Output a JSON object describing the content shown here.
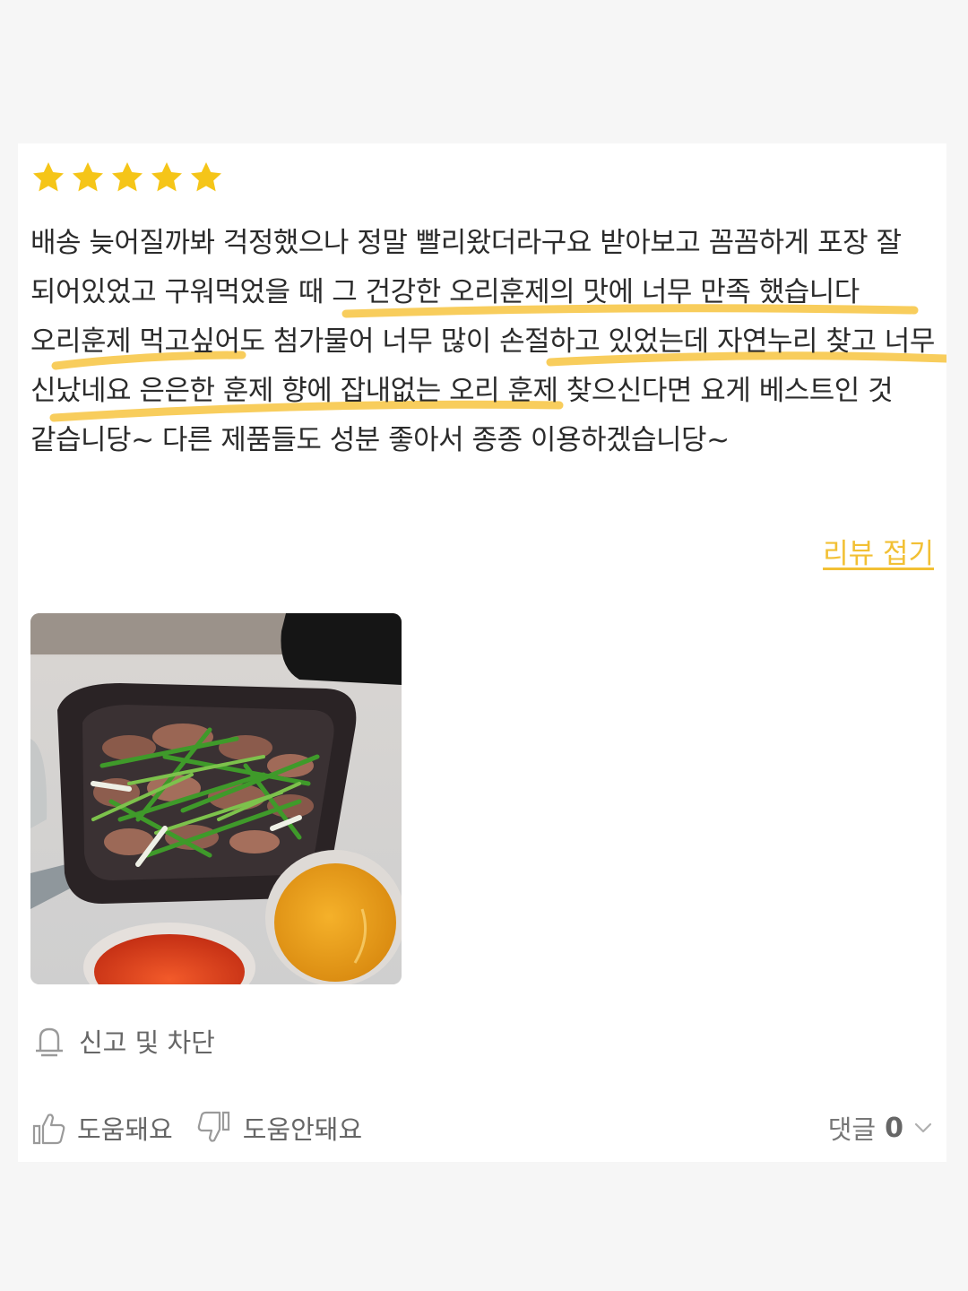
{
  "review": {
    "rating": 5,
    "rating_max": 5,
    "star_color": "#F5C518",
    "highlight_color": "#F7C84A",
    "text": "배송 늦어질까봐 걱정했으나 정말 빨리왔더라구요 받아보고 꼼꼼하게 포장 잘 되어있었고 구워먹었을 때 그 건강한 오리훈제의 맛에 너무 만족 했습니다 오리훈제 먹고싶어도 첨가물어 너무 많이 손절하고 있었는데 자연누리 찾고 너무 신났네요 은은한 훈제 향에 잡내없는 오리 훈제 찾으신다면 요게 베스트인 것 같습니당~ 다른 제품들도 성분 좋아서 종종 이용하겠습니당~",
    "fold_link": "리뷰 접기",
    "photo_icon": "food-photo"
  },
  "actions": {
    "report_label": "신고 및 차단",
    "report_icon": "bell-icon",
    "helpful_label": "도움돼요",
    "helpful_icon": "thumbs-up-icon",
    "not_helpful_label": "도움안돼요",
    "not_helpful_icon": "thumbs-down-icon",
    "comments_label": "댓글",
    "comments_count": "0",
    "comments_icon": "chevron-down-icon"
  }
}
